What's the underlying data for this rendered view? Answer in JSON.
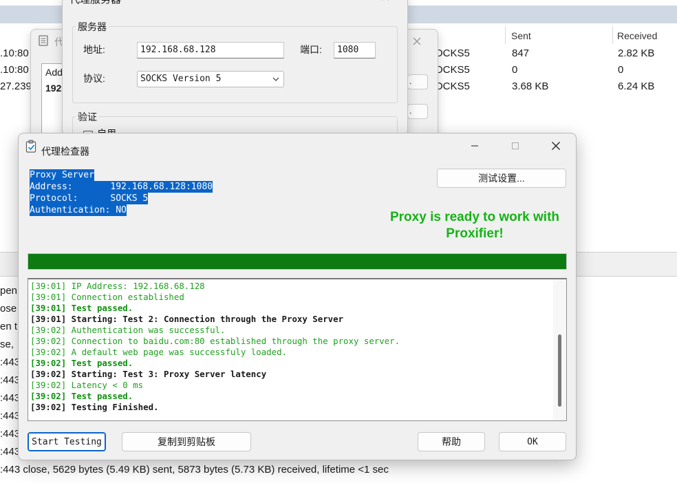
{
  "background": {
    "columns": {
      "sent": "Sent",
      "received": "Received"
    },
    "rows": [
      {
        "addr": ".10:80",
        "protocol": "OCKS5",
        "sent": "847",
        "received": "2.82 KB"
      },
      {
        "addr": ".10:80",
        "protocol": "OCKS5",
        "sent": "0",
        "received": "0"
      },
      {
        "addr": "27.239",
        "protocol": "OCKS5",
        "sent": "3.68 KB",
        "received": "6.24 KB"
      }
    ],
    "log_fragments": [
      "pen",
      "ose",
      "en t",
      "se,",
      ":443",
      ":443",
      ":443",
      ":443",
      ":443",
      ":443"
    ],
    "bottom_line": ":443 close, 5629 bytes (5.49 KB) sent, 5873 bytes (5.73 KB) received, lifetime <1 sec"
  },
  "middle_dialog": {
    "title_fragment": "代",
    "list_header_fragment": "Add",
    "list_value_fragment": "192"
  },
  "server_dialog": {
    "title": "代理服务器",
    "server_group": "服务器",
    "address_label": "地址:",
    "address_value": "192.168.68.128",
    "port_label": "端口:",
    "port_value": "1080",
    "protocol_label": "协议:",
    "protocol_value": "SOCKS Version 5",
    "auth_group": "验证",
    "auth_checkbox_label": "启用"
  },
  "checker": {
    "title": "代理检查器",
    "info_lines": [
      "Proxy Server",
      "Address:       192.168.68.128:1080",
      "Protocol:      SOCKS 5",
      "Authentication: NO"
    ],
    "settings_button": "测试设置...",
    "ready_message": "Proxy is ready to work with Proxifier!",
    "progress": 1.0,
    "log": [
      {
        "text": "[39:01] IP Address: 192.168.68.128",
        "style": "g"
      },
      {
        "text": "[39:01] Connection established",
        "style": "g"
      },
      {
        "text": "[39:01] Test passed.",
        "style": "gb"
      },
      {
        "text": "[39:01] Starting: Test 2: Connection through the Proxy Server",
        "style": "k"
      },
      {
        "text": "[39:02] Authentication was successful.",
        "style": "g"
      },
      {
        "text": "[39:02] Connection to baidu.com:80 established through the proxy server.",
        "style": "g"
      },
      {
        "text": "[39:02] A default web page was successfuly loaded.",
        "style": "g"
      },
      {
        "text": "[39:02] Test passed.",
        "style": "gb"
      },
      {
        "text": "[39:02] Starting: Test 3: Proxy Server latency",
        "style": "k"
      },
      {
        "text": "[39:02] Latency < 0 ms",
        "style": "g"
      },
      {
        "text": "[39:02] Test passed.",
        "style": "gb"
      },
      {
        "text": "[39:02] Testing Finished.",
        "style": "k"
      }
    ],
    "buttons": {
      "start": "Start Testing",
      "copy": "复制到剪贴板",
      "help": "帮助",
      "ok": "OK"
    }
  },
  "colors": {
    "selection": "#0a64c8",
    "success_text": "#15b315",
    "progress_fill": "#0e7a12"
  }
}
